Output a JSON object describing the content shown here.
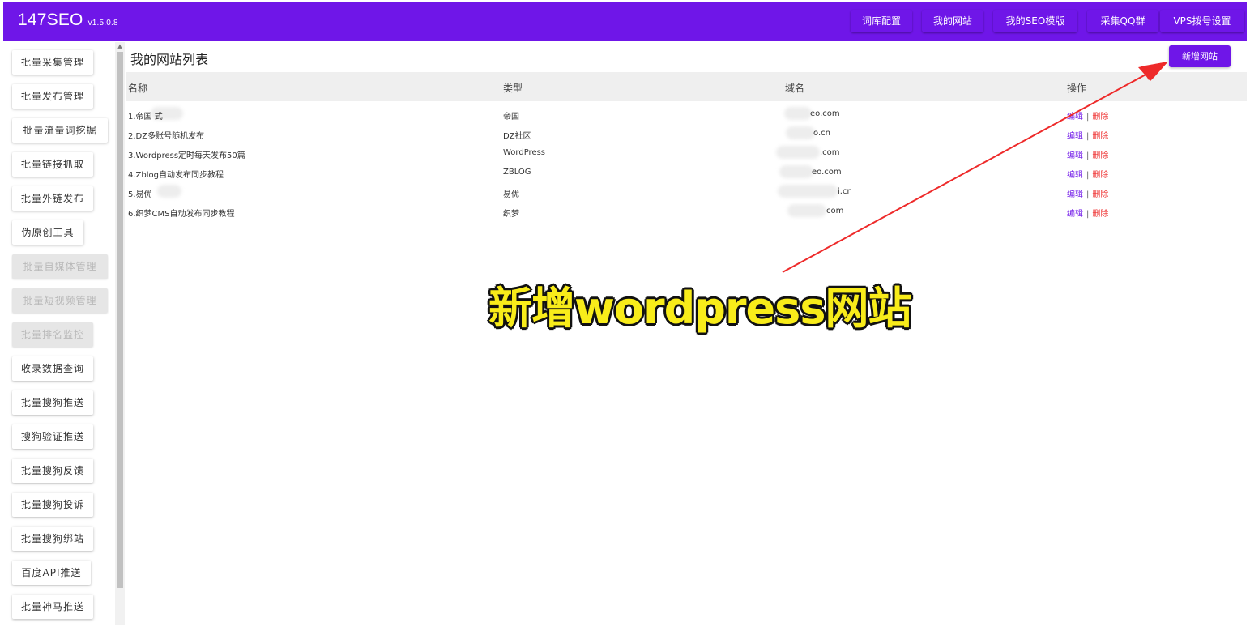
{
  "header": {
    "brand": "147SEO",
    "version": "v1.5.0.8",
    "nav": [
      "词库配置",
      "我的网站",
      "我的SEO模版",
      "采集QQ群",
      "VPS拨号设置"
    ],
    "bg_color": "#6f16e8"
  },
  "sidebar": {
    "items": [
      {
        "label": "批量采集管理",
        "disabled": false
      },
      {
        "label": "批量发布管理",
        "disabled": false
      },
      {
        "label": "批量流量词挖掘",
        "disabled": false
      },
      {
        "label": "批量链接抓取",
        "disabled": false
      },
      {
        "label": "批量外链发布",
        "disabled": false
      },
      {
        "label": "伪原创工具",
        "disabled": false
      },
      {
        "label": "批量自媒体管理",
        "disabled": true
      },
      {
        "label": "批量短视频管理",
        "disabled": true
      },
      {
        "label": "批量排名监控",
        "disabled": true
      },
      {
        "label": "收录数据查询",
        "disabled": false
      },
      {
        "label": "批量搜狗推送",
        "disabled": false
      },
      {
        "label": "搜狗验证推送",
        "disabled": false
      },
      {
        "label": "批量搜狗反馈",
        "disabled": false
      },
      {
        "label": "批量搜狗投诉",
        "disabled": false
      },
      {
        "label": "批量搜狗绑站",
        "disabled": false
      },
      {
        "label": "百度API推送",
        "disabled": false
      },
      {
        "label": "批量神马推送",
        "disabled": false
      }
    ]
  },
  "main": {
    "title": "我的网站列表",
    "add_button": "新增网站",
    "columns": [
      "名称",
      "类型",
      "域名",
      "操作"
    ],
    "rows": [
      {
        "name": "1.帝国          式",
        "type": "帝国",
        "domain": "eo.com",
        "edit": "编辑",
        "sep": "|",
        "del": "删除"
      },
      {
        "name": "2.DZ多账号随机发布",
        "type": "DZ社区",
        "domain": "o.cn",
        "edit": "编辑",
        "sep": "|",
        "del": "删除"
      },
      {
        "name": "3.Wordpress定时每天发布50篇",
        "type": "WordPress",
        "domain": ".com",
        "edit": "编辑",
        "sep": "|",
        "del": "删除"
      },
      {
        "name": "4.Zblog自动发布同步教程",
        "type": "ZBLOG",
        "domain": "eo.com",
        "edit": "编辑",
        "sep": "|",
        "del": "删除"
      },
      {
        "name": "5.易优",
        "type": "易优",
        "domain": "i.cn",
        "edit": "编辑",
        "sep": "|",
        "del": "删除"
      },
      {
        "name": "6.织梦CMS自动发布同步教程",
        "type": "织梦",
        "domain": "com",
        "edit": "编辑",
        "sep": "|",
        "del": "删除"
      }
    ]
  },
  "overlay": {
    "caption": "新增wordpress网站",
    "caption_color": "#f8ec1a",
    "arrow_color": "#ee2a2a"
  }
}
